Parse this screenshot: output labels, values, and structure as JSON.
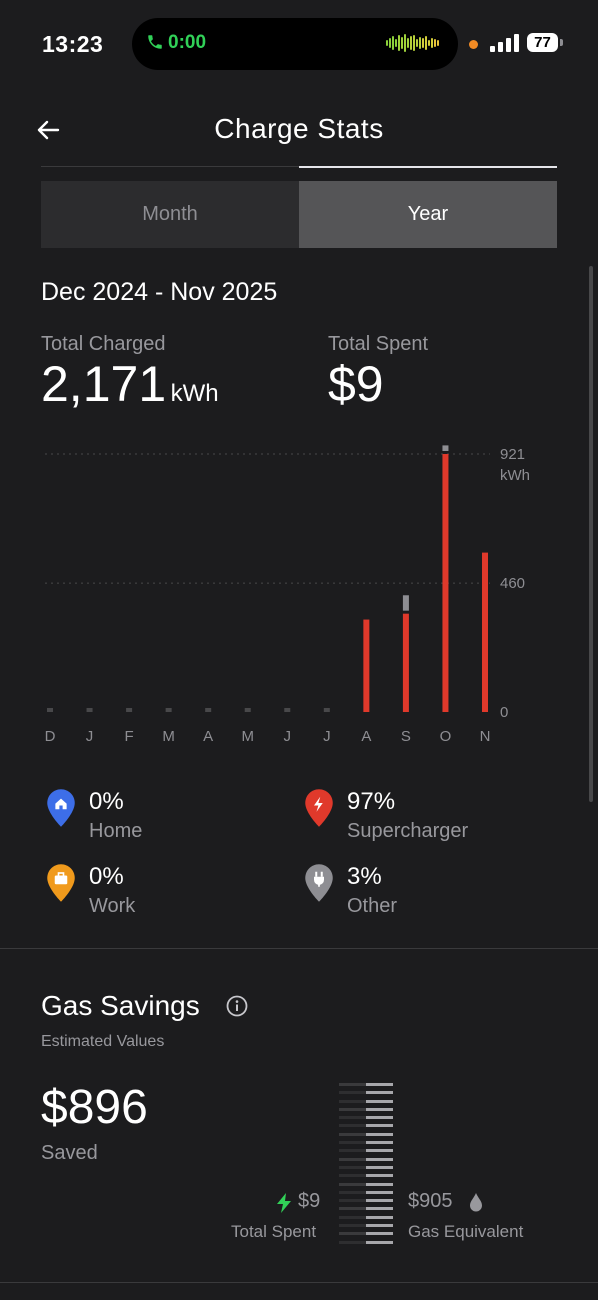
{
  "status": {
    "time": "13:23",
    "call_time": "0:00",
    "battery": "77"
  },
  "header": {
    "title": "Charge Stats"
  },
  "tabs": {
    "month": "Month",
    "year": "Year",
    "selected": "Year"
  },
  "range": "Dec 2024 - Nov 2025",
  "totals": {
    "charged_label": "Total Charged",
    "charged_value": "2,171",
    "charged_unit": "kWh",
    "spent_label": "Total Spent",
    "spent_value": "$9"
  },
  "chart_data": {
    "type": "bar",
    "categories": [
      "D",
      "J",
      "F",
      "M",
      "A",
      "M",
      "J",
      "J",
      "A",
      "S",
      "O",
      "N"
    ],
    "series": [
      {
        "values": [
          0,
          0,
          0,
          0,
          0,
          0,
          0,
          0,
          330,
          351,
          921,
          569
        ],
        "color": "#e0392b"
      },
      {
        "values": [
          0,
          0,
          0,
          0,
          0,
          0,
          0,
          0,
          0,
          55,
          20,
          0
        ],
        "color": "#8e8e93"
      }
    ],
    "ylim": [
      0,
      921
    ],
    "yticks": [
      "921",
      "460",
      "0"
    ],
    "yunit": "kWh",
    "grid": true
  },
  "legend": [
    {
      "pct": "0%",
      "label": "Home",
      "color": "#3d6ee8",
      "icon": "home-pin-icon"
    },
    {
      "pct": "97%",
      "label": "Supercharger",
      "color": "#e0392b",
      "icon": "bolt-pin-icon"
    },
    {
      "pct": "0%",
      "label": "Work",
      "color": "#f09a1c",
      "icon": "briefcase-pin-icon"
    },
    {
      "pct": "3%",
      "label": "Other",
      "color": "#8e8e93",
      "icon": "plug-pin-icon"
    }
  ],
  "gas": {
    "title": "Gas Savings",
    "subtitle": "Estimated Values",
    "saved_value": "$896",
    "saved_label": "Saved",
    "spent_value": "$9",
    "spent_label": "Total Spent",
    "gas_value": "$905",
    "gas_label": "Gas Equivalent"
  }
}
